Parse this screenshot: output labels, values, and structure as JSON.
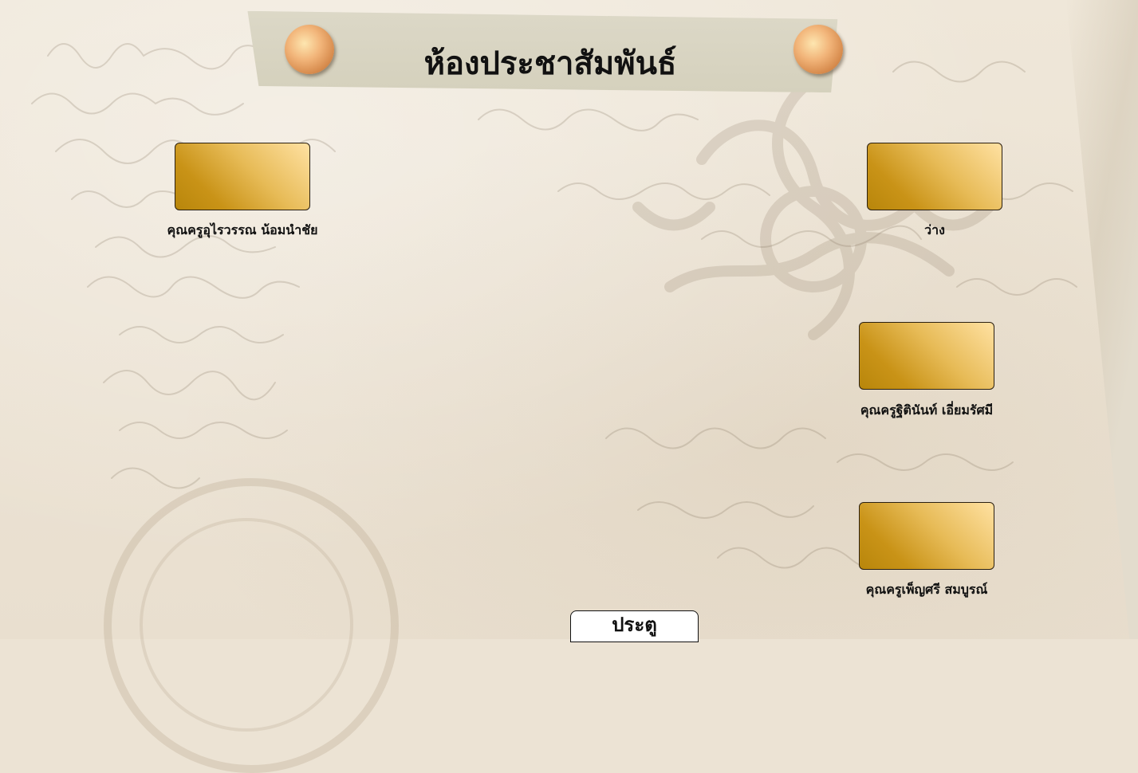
{
  "page": {
    "title": "ห้องประชาสัมพันธ์"
  },
  "seats": [
    {
      "label": "คุณครูอุไรวรรณ น้อมนำชัย"
    },
    {
      "label": "ว่าง"
    },
    {
      "label": "คุณครูฐิตินันท์ เอี่ยมรัศมี"
    },
    {
      "label": "คุณครูเพ็ญศรี สมบูรณ์"
    }
  ],
  "door": {
    "label": "ประตู"
  },
  "colors": {
    "paper": "#ece3d4",
    "tape": "#d8d4c2",
    "desk_light": "#ffe1a2",
    "desk_dark": "#b8860b",
    "pin": "#e8a868"
  },
  "icons": {
    "pin": "thumbtack-pin-icon"
  }
}
